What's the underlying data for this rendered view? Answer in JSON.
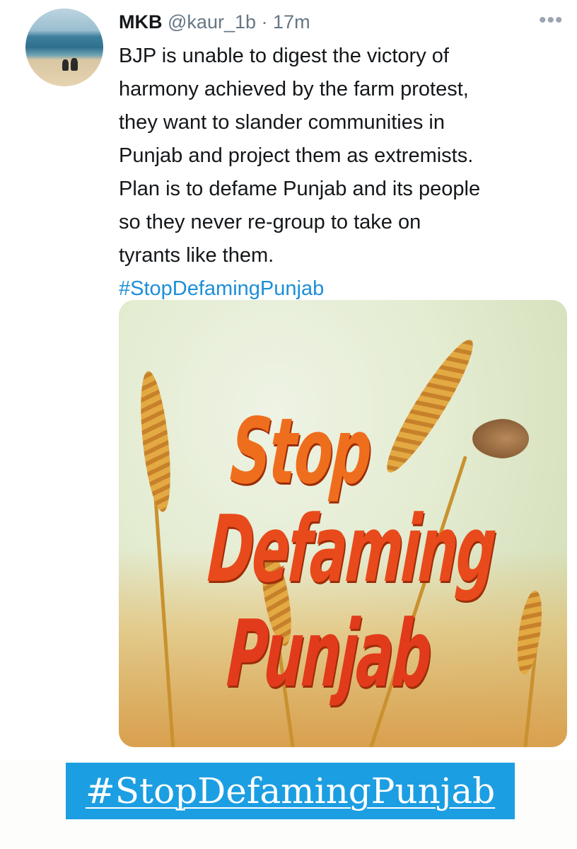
{
  "tweet": {
    "author_name": "MKB",
    "handle": "@kaur_1b",
    "separator": "·",
    "time": "17m",
    "more_label": "•••",
    "text_lines": [
      "BJP is unable to digest the victory of",
      "harmony achieved by the farm protest,",
      "they want to slander communities in",
      "Punjab and project them as extremists.",
      "Plan is to defame Punjab and its people",
      "so they never re-group to take on",
      "tyrants like them."
    ],
    "hashtag": "#StopDefamingPunjab"
  },
  "media": {
    "poster_lines": [
      "Stop",
      "Defaming",
      "Punjab"
    ]
  },
  "banner": {
    "text": "#StopDefamingPunjab",
    "color": "#1c9ee2"
  },
  "colors": {
    "link": "#1d8fd8",
    "poster_orange": "#e8581a"
  }
}
